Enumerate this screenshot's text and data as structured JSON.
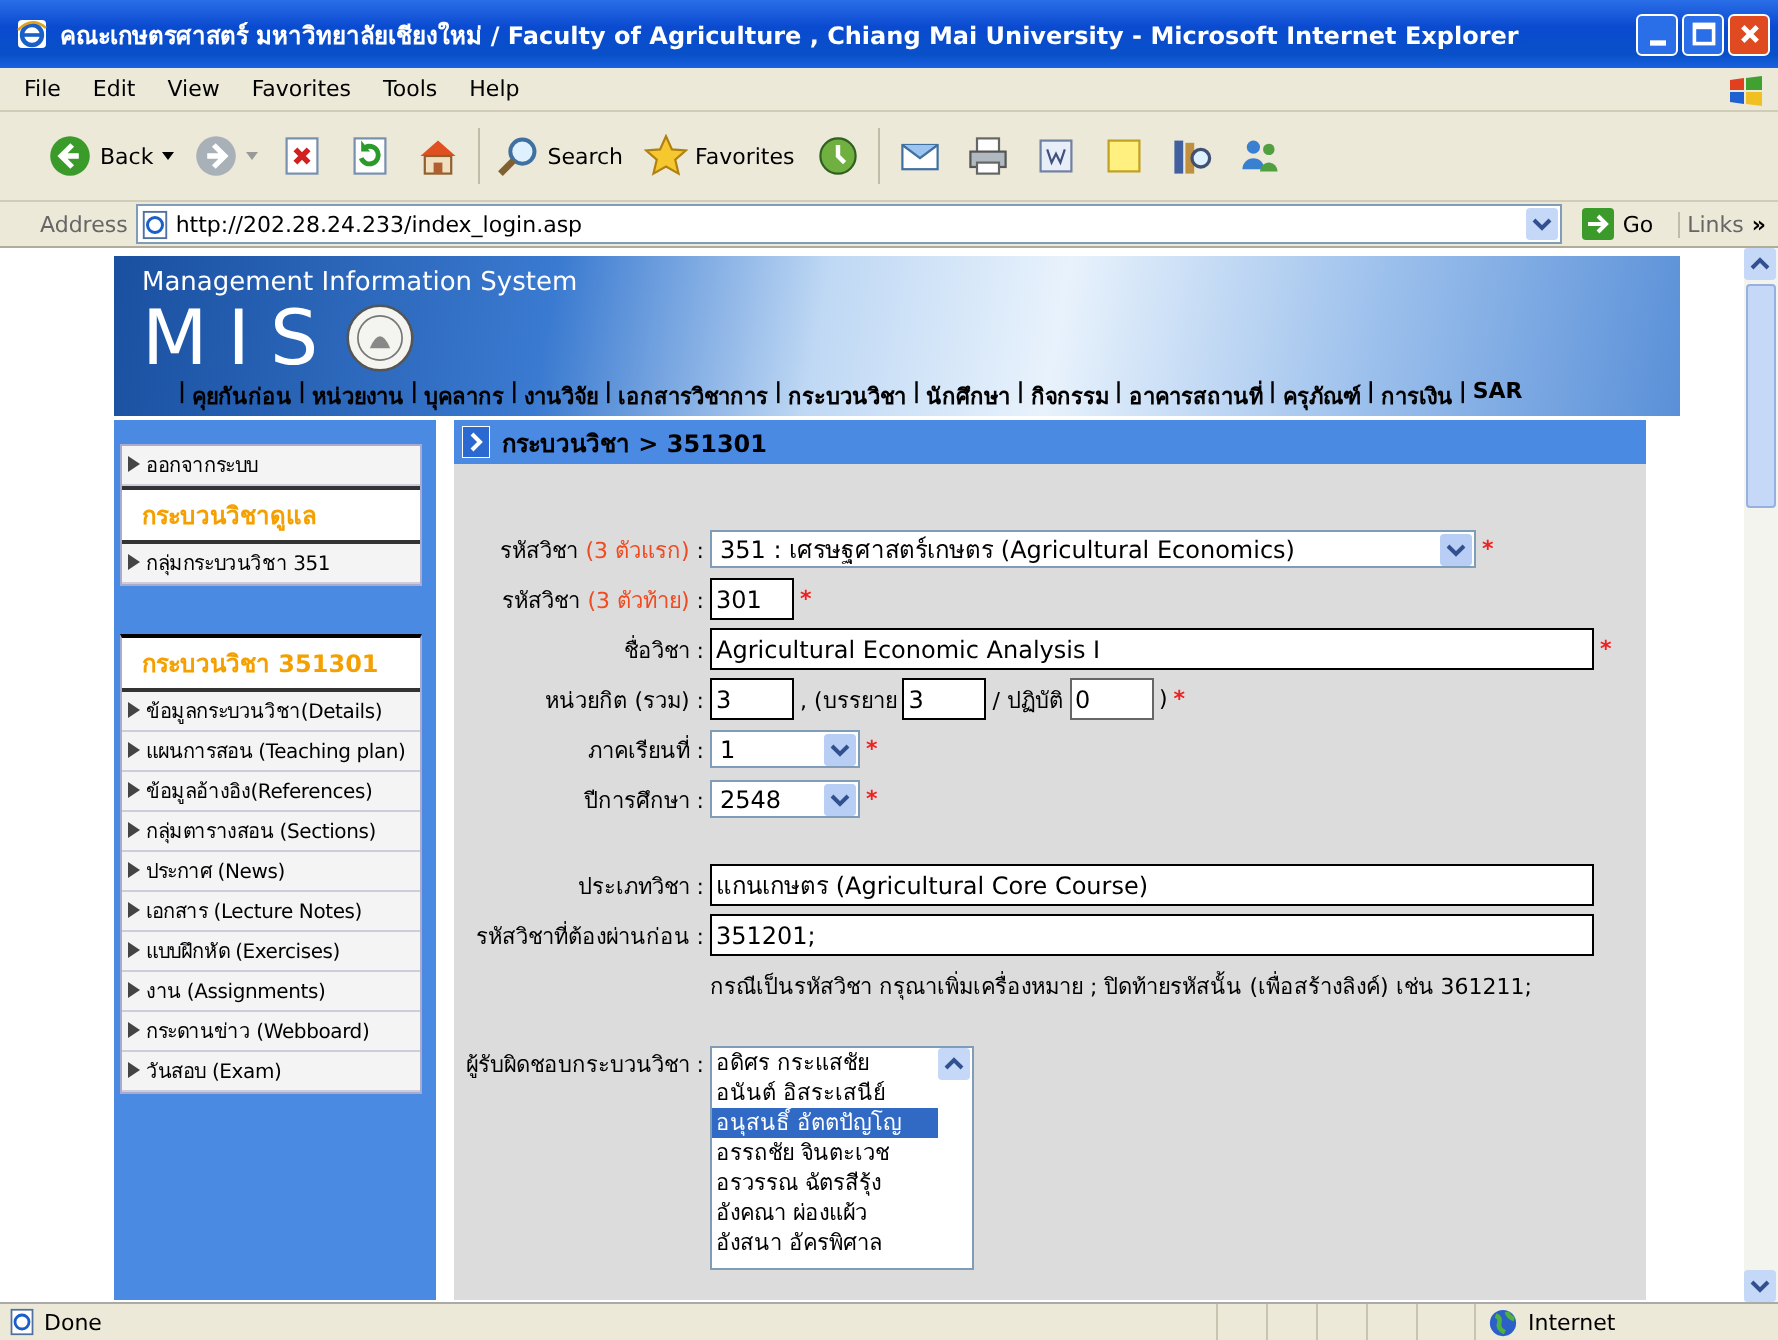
{
  "window": {
    "title": "คณะเกษตรศาสตร์ มหาวิทยาลัยเชียงใหม่ / Faculty of Agriculture , Chiang Mai University   - Microsoft Internet Explorer"
  },
  "menu_bar": [
    "File",
    "Edit",
    "View",
    "Favorites",
    "Tools",
    "Help"
  ],
  "toolbar": {
    "back_label": "Back",
    "search_label": "Search",
    "favorites_label": "Favorites"
  },
  "address_bar": {
    "label": "Address",
    "url": "http://202.28.24.233/index_login.asp",
    "go_label": "Go",
    "links_label": "Links",
    "links_more": "»"
  },
  "banner": {
    "subtitle": "Management Information System",
    "logo_text": "MIS",
    "separator": "|",
    "nav_links": [
      "คุยกันก่อน",
      "หน่วยงาน",
      "บุคลากร",
      "งานวิจัย",
      "เอกสารวิชาการ",
      "กระบวนวิชา",
      "นักศึกษา",
      "กิจกรรม",
      "อาคารสถานที่",
      "ครุภัณฑ์",
      "การเงิน",
      "SAR"
    ]
  },
  "sidebar": {
    "top_items": [
      {
        "kind": "link",
        "label": "ออกจากระบบ"
      },
      {
        "kind": "heading",
        "label": "กระบวนวิชาดูแล"
      },
      {
        "kind": "link",
        "label": "กลุ่มกระบวนวิชา 351"
      }
    ],
    "course_panel": {
      "title": "กระบวนวิชา 351301",
      "items": [
        "ข้อมูลกระบวนวิชา(Details)",
        "แผนการสอน (Teaching plan)",
        "ข้อมูลอ้างอิง(References)",
        "กลุ่มตารางสอน (Sections)",
        "ประกาศ (News)",
        "เอกสาร (Lecture Notes)",
        "แบบฝึกหัด (Exercises)",
        "งาน (Assignments)",
        "กระดานข่าว (Webboard)",
        "วันสอบ (Exam)"
      ]
    }
  },
  "breadcrumb": "กระบวนวิชา > 351301",
  "form": {
    "colon": ":",
    "required_mark": "*",
    "rows": [
      {
        "kind": "wideselect",
        "label": "รหัสวิชา",
        "hint": "(3 ตัวแรก)",
        "value": "351 : เศรษฐศาสตร์เกษตร (Agricultural Economics)",
        "required": true
      },
      {
        "kind": "shortinput",
        "label": "รหัสวิชา",
        "hint": "(3 ตัวท้าย)",
        "value": "301",
        "required": true
      },
      {
        "kind": "input",
        "label": "ชื่อวิชา",
        "value": "Agricultural Economic Analysis I",
        "required": true
      },
      {
        "kind": "credits",
        "label": "หน่วยกิต (รวม)",
        "value": "3",
        "lecture_label": ", (บรรยาย",
        "lecture_value": "3",
        "lab_label": "/ ปฏิบัติ",
        "lab_value": "0",
        "close": ")",
        "required": true
      },
      {
        "kind": "select",
        "label": "ภาคเรียนที่",
        "value": "1",
        "required": true
      },
      {
        "kind": "select",
        "label": "ปีการศึกษา",
        "value": "2548",
        "required": true
      },
      {
        "kind": "spacer"
      },
      {
        "kind": "input",
        "label": "ประเภทวิชา",
        "value": "แกนเกษตร (Agricultural Core Course)",
        "required": false
      },
      {
        "kind": "input",
        "label": "รหัสวิชาที่ต้องผ่านก่อน",
        "value": "351201;",
        "required": false
      },
      {
        "kind": "note",
        "text": "กรณีเป็นรหัสวิชา กรุณาเพิ่มเครื่องหมาย ; ปิดท้ายรหัสนั้น (เพื่อสร้างลิงค์) เช่น 361211;"
      },
      {
        "kind": "spacer"
      },
      {
        "kind": "listbox",
        "label": "ผู้รับผิดชอบกระบวนวิชา",
        "options": [
          {
            "label": "อดิศร กระแสชัย",
            "selected": false
          },
          {
            "label": "อนันต์ อิสระเสนีย์",
            "selected": false
          },
          {
            "label": "อนุสนธิ์ อัตตปัญโญ",
            "selected": true
          },
          {
            "label": "อรรถชัย จินตะเวช",
            "selected": false
          },
          {
            "label": "อรวรรณ ฉัตรสีรุ้ง",
            "selected": false
          },
          {
            "label": "อังคณา ผ่องแผ้ว",
            "selected": false
          },
          {
            "label": "อังสนา อัครพิศาล",
            "selected": false
          }
        ]
      }
    ]
  },
  "status_bar": {
    "text": "Done",
    "zone": "Internet"
  }
}
